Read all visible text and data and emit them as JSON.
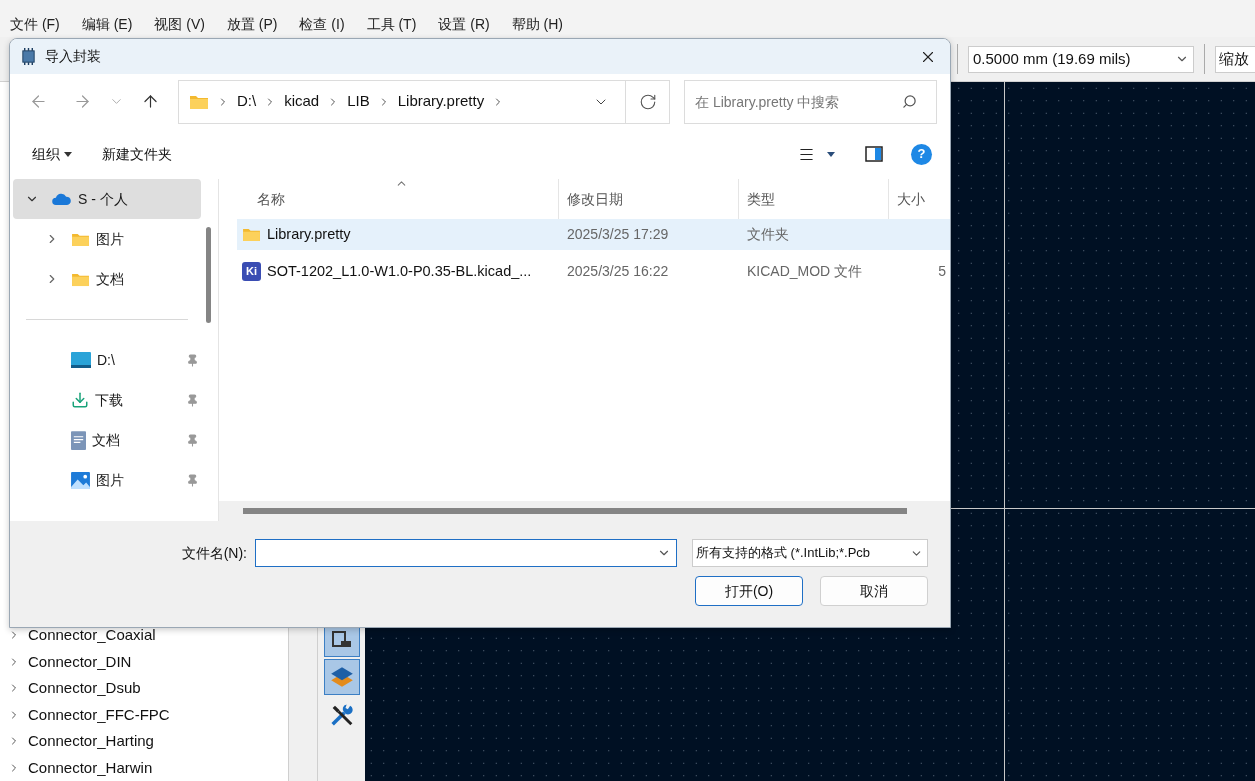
{
  "menu_bar": [
    "文件 (F)",
    "编辑 (E)",
    "视图 (V)",
    "放置 (P)",
    "检查 (I)",
    "工具 (T)",
    "设置 (R)",
    "帮助 (H)"
  ],
  "toolbar": {
    "grid": "0.5000 mm (19.69 mils)",
    "zoom": "缩放"
  },
  "library_tree": [
    "Connector_Coaxial",
    "Connector_DIN",
    "Connector_Dsub",
    "Connector_FFC-FPC",
    "Connector_Harting",
    "Connector_Harwin"
  ],
  "side_toolbar": [
    {
      "kind": "footprint",
      "selected": true
    },
    {
      "kind": "layers",
      "selected": true
    },
    {
      "kind": "tools",
      "selected": false
    }
  ],
  "dialog": {
    "title": "导入封装",
    "breadcrumb": [
      "D:\\",
      "kicad",
      "LIB",
      "Library.pretty"
    ],
    "search": {
      "placeholder": "在 Library.pretty 中搜索"
    },
    "commands": [
      "组织",
      "新建文件夹"
    ],
    "help": "?",
    "nav_pane": [
      {
        "kind": "cloud",
        "label": "S - 个人",
        "selected": true,
        "expanded": true,
        "children": [
          {
            "kind": "folder",
            "label": "图片",
            "selected": false,
            "expanded": false
          },
          {
            "kind": "folder",
            "label": "文档",
            "selected": false,
            "expanded": false
          }
        ]
      },
      {
        "kind": "drive",
        "label": "D:\\",
        "selected": false,
        "pinned": true
      },
      {
        "kind": "download",
        "label": "下载",
        "selected": false,
        "pinned": true
      },
      {
        "kind": "documents",
        "label": "文档",
        "selected": false,
        "pinned": true
      },
      {
        "kind": "pictures",
        "label": "图片",
        "selected": false,
        "pinned": true
      }
    ],
    "columns": [
      {
        "label": "名称",
        "sorted": true
      },
      {
        "label": "修改日期",
        "sorted": false
      },
      {
        "label": "类型",
        "sorted": false
      },
      {
        "label": "大小",
        "sorted": false
      }
    ],
    "files": [
      {
        "kind": "folder",
        "name": "Library.pretty",
        "modified": "2025/3/25 17:29",
        "type": "文件夹",
        "selected": true
      },
      {
        "kind": "kicad",
        "badge": "Ki",
        "name": "SOT-1202_L1.0-W1.0-P0.35-BL.kicad_...",
        "modified": "2025/3/25 16:22",
        "type": "KICAD_MOD 文件",
        "size": "5",
        "selected": false
      }
    ],
    "filename_label": "文件名(N):",
    "filter": "所有支持的格式 (*.IntLib;*.Pcb",
    "buttons": [
      {
        "label": "打开(O)",
        "primary": true
      },
      {
        "label": "取消",
        "primary": false
      }
    ]
  }
}
